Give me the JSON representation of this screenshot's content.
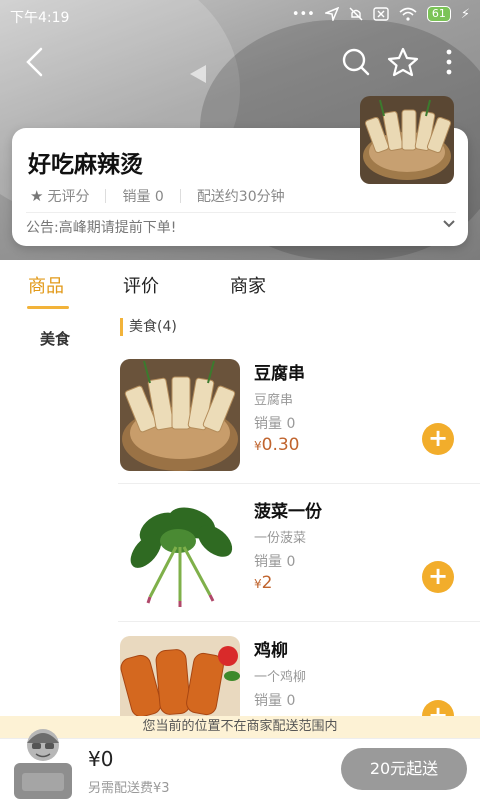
{
  "status_bar": {
    "time": "下午4:19",
    "battery": "61"
  },
  "toolbar": {
    "back_icon": "back-chevron-icon",
    "search_icon": "search-icon",
    "favorite_icon": "star-outline-icon",
    "more_icon": "more-vertical-icon"
  },
  "shop": {
    "name": "好吃麻辣烫",
    "rating": "无评分",
    "sales": "销量 0",
    "delivery": "配送约30分钟",
    "notice": "公告:高峰期请提前下单!"
  },
  "tabs": [
    {
      "label": "商品",
      "active": true
    },
    {
      "label": "评价",
      "active": false
    },
    {
      "label": "商家",
      "active": false
    }
  ],
  "categories": [
    {
      "label": "美食"
    }
  ],
  "section": {
    "label": "美食(4)"
  },
  "products": [
    {
      "name": "豆腐串",
      "desc": "豆腐串",
      "sales": "销量 0",
      "price_symbol": "¥",
      "price": "0.30",
      "image": "tofu-skewers-photo"
    },
    {
      "name": "菠菜一份",
      "desc": "一份菠菜",
      "sales": "销量 0",
      "price_symbol": "¥",
      "price": "2",
      "image": "spinach-photo"
    },
    {
      "name": "鸡柳",
      "desc": "一个鸡柳",
      "sales": "销量 0",
      "price_symbol": "¥",
      "price": "",
      "image": "chicken-strips-photo"
    }
  ],
  "range_notice": "您当前的位置不在商家配送范围内",
  "cart": {
    "total": "¥0",
    "delivery_fee": "另需配送费¥3",
    "checkout_label": "20元起送"
  },
  "colors": {
    "accent": "#f2ad2b",
    "active_tab": "#e29a1a",
    "price": "#c0642e",
    "checkout_disabled": "#9a9a9a"
  }
}
